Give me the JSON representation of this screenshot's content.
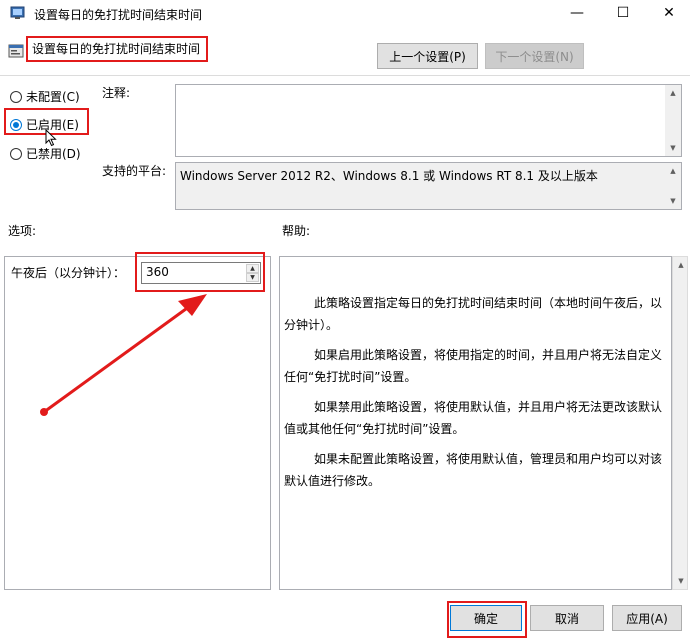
{
  "window": {
    "title": "设置每日的免打扰时间结束时间",
    "minimize_glyph": "—",
    "maximize_glyph": "☐",
    "close_glyph": "✕"
  },
  "header": {
    "policy_title": "设置每日的免打扰时间结束时间",
    "prev_label": "上一个设置(P)",
    "next_label": "下一个设置(N)"
  },
  "state": {
    "options": [
      {
        "label": "未配置(C)",
        "checked": false
      },
      {
        "label": "已启用(E)",
        "checked": true
      },
      {
        "label": "已禁用(D)",
        "checked": false
      }
    ]
  },
  "comment": {
    "label": "注释:",
    "value": ""
  },
  "platform": {
    "label": "支持的平台:",
    "value": "Windows Server 2012 R2、Windows 8.1 或 Windows RT 8.1 及以上版本"
  },
  "options_section": {
    "label": "选项:",
    "field_label": "午夜后（以分钟计）：",
    "field_value": "360"
  },
  "help_section": {
    "label": "帮助:",
    "paragraphs": [
      "此策略设置指定每日的免打扰时间结束时间（本地时间午夜后，以分钟计）。",
      "如果启用此策略设置，将使用指定的时间，并且用户将无法自定义任何“免打扰时间”设置。",
      "如果禁用此策略设置，将使用默认值，并且用户将无法更改该默认值或其他任何“免打扰时间”设置。",
      "如果未配置此策略设置，将使用默认值，管理员和用户均可以对该默认值进行修改。"
    ]
  },
  "footer": {
    "ok_label": "确定",
    "cancel_label": "取消",
    "apply_label": "应用(A)"
  },
  "colors": {
    "annotation_red": "#e21b1b",
    "accent_blue": "#0078d7"
  }
}
